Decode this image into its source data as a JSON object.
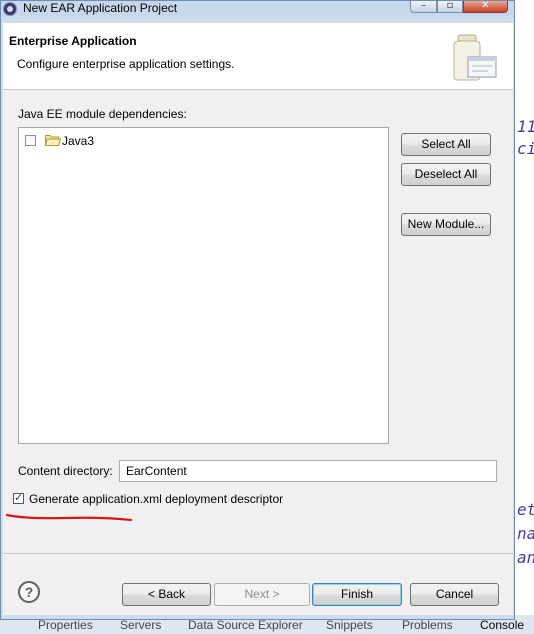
{
  "window": {
    "title": "New EAR Application Project",
    "controls": {
      "minimize": "–",
      "maximize": "▫",
      "close": "✕"
    }
  },
  "banner": {
    "title": "Enterprise Application",
    "description": "Configure enterprise application settings.",
    "icon": "ear-jar-icon"
  },
  "dependencies": {
    "label": "Java EE module dependencies:",
    "items": [
      {
        "label": "Java3",
        "checked": false,
        "icon": "folder-icon"
      }
    ]
  },
  "side_buttons": {
    "select_all": "Select All",
    "deselect_all": "Deselect All",
    "new_module": "New Module..."
  },
  "content_directory": {
    "label": "Content directory:",
    "value": "EarContent"
  },
  "generate_descriptor": {
    "label": "Generate application.xml deployment descriptor",
    "checked": true
  },
  "footer": {
    "help_icon": "?",
    "back": "< Back",
    "next": "Next >",
    "finish": "Finish",
    "cancel": "Cancel"
  },
  "background_ide": {
    "bottom_tabs": [
      "Properties",
      "Servers",
      "Data Source Explorer",
      "Snippets",
      "Problems",
      "Console"
    ],
    "code_fragments": [
      "11",
      "ci",
      "et",
      "na",
      "an"
    ]
  },
  "colors": {
    "annotation_red": "#d8141a",
    "finish_border": "#3c7fb1",
    "code_text": "#4a3aa8"
  }
}
